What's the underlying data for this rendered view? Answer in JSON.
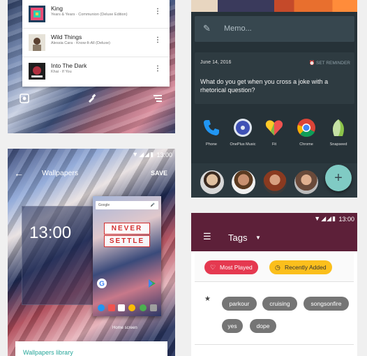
{
  "music": {
    "songs": [
      {
        "title": "King",
        "subtitle": "Years & Years · Communion (Deluxe Edition)"
      },
      {
        "title": "Wild Things",
        "subtitle": "Alessia Cara · Know-It-All (Deluxe)"
      },
      {
        "title": "Into The Dark",
        "subtitle": "Khai · If You"
      }
    ],
    "more_icon": "⋮",
    "toolbar_icons": [
      "settings-icon",
      "brush-icon",
      "sort-icon"
    ]
  },
  "shelf": {
    "memo_placeholder": "Memo...",
    "note": {
      "date": "June 14, 2016",
      "reminder_label": "SET REMINDER",
      "text": "What do you get when you cross a joke with a rhetorical question?"
    },
    "apps": [
      {
        "label": "Phone",
        "icon": "phone-icon",
        "color": "#2196f3"
      },
      {
        "label": "OnePlus Music",
        "icon": "oneplus-music-icon",
        "color": "#3f51b5"
      },
      {
        "label": "Fit",
        "icon": "fit-icon",
        "color": "#ef5350"
      },
      {
        "label": "Chrome",
        "icon": "chrome-icon",
        "color": "#4caf50"
      },
      {
        "label": "Snapseed",
        "icon": "snapseed-icon",
        "color": "#8bc34a"
      }
    ],
    "fab_label": "+"
  },
  "wallpapers": {
    "status_time": "13:00",
    "title": "Wallpapers",
    "save_label": "SAVE",
    "lock_time": "13:00",
    "search_label": "Google",
    "home_text_1": "NEVER",
    "home_text_2": "SETTLE",
    "home_screen_label": "Home screen",
    "library_label": "Wallpapers library"
  },
  "tags": {
    "status_time": "13:00",
    "title": "Tags",
    "sorts": [
      {
        "label": "Most Played",
        "bg": "#e53950",
        "fg": "#ffffff"
      },
      {
        "label": "Recently Added",
        "bg": "#fbbf1c",
        "fg": "#333333"
      }
    ],
    "items": [
      "parkour",
      "cruising",
      "songsonfire",
      "yes",
      "dope"
    ]
  },
  "colors": {
    "shelf_bg": "#263238",
    "tags_bar": "#5d2039",
    "accent_teal": "#80cbc4"
  }
}
